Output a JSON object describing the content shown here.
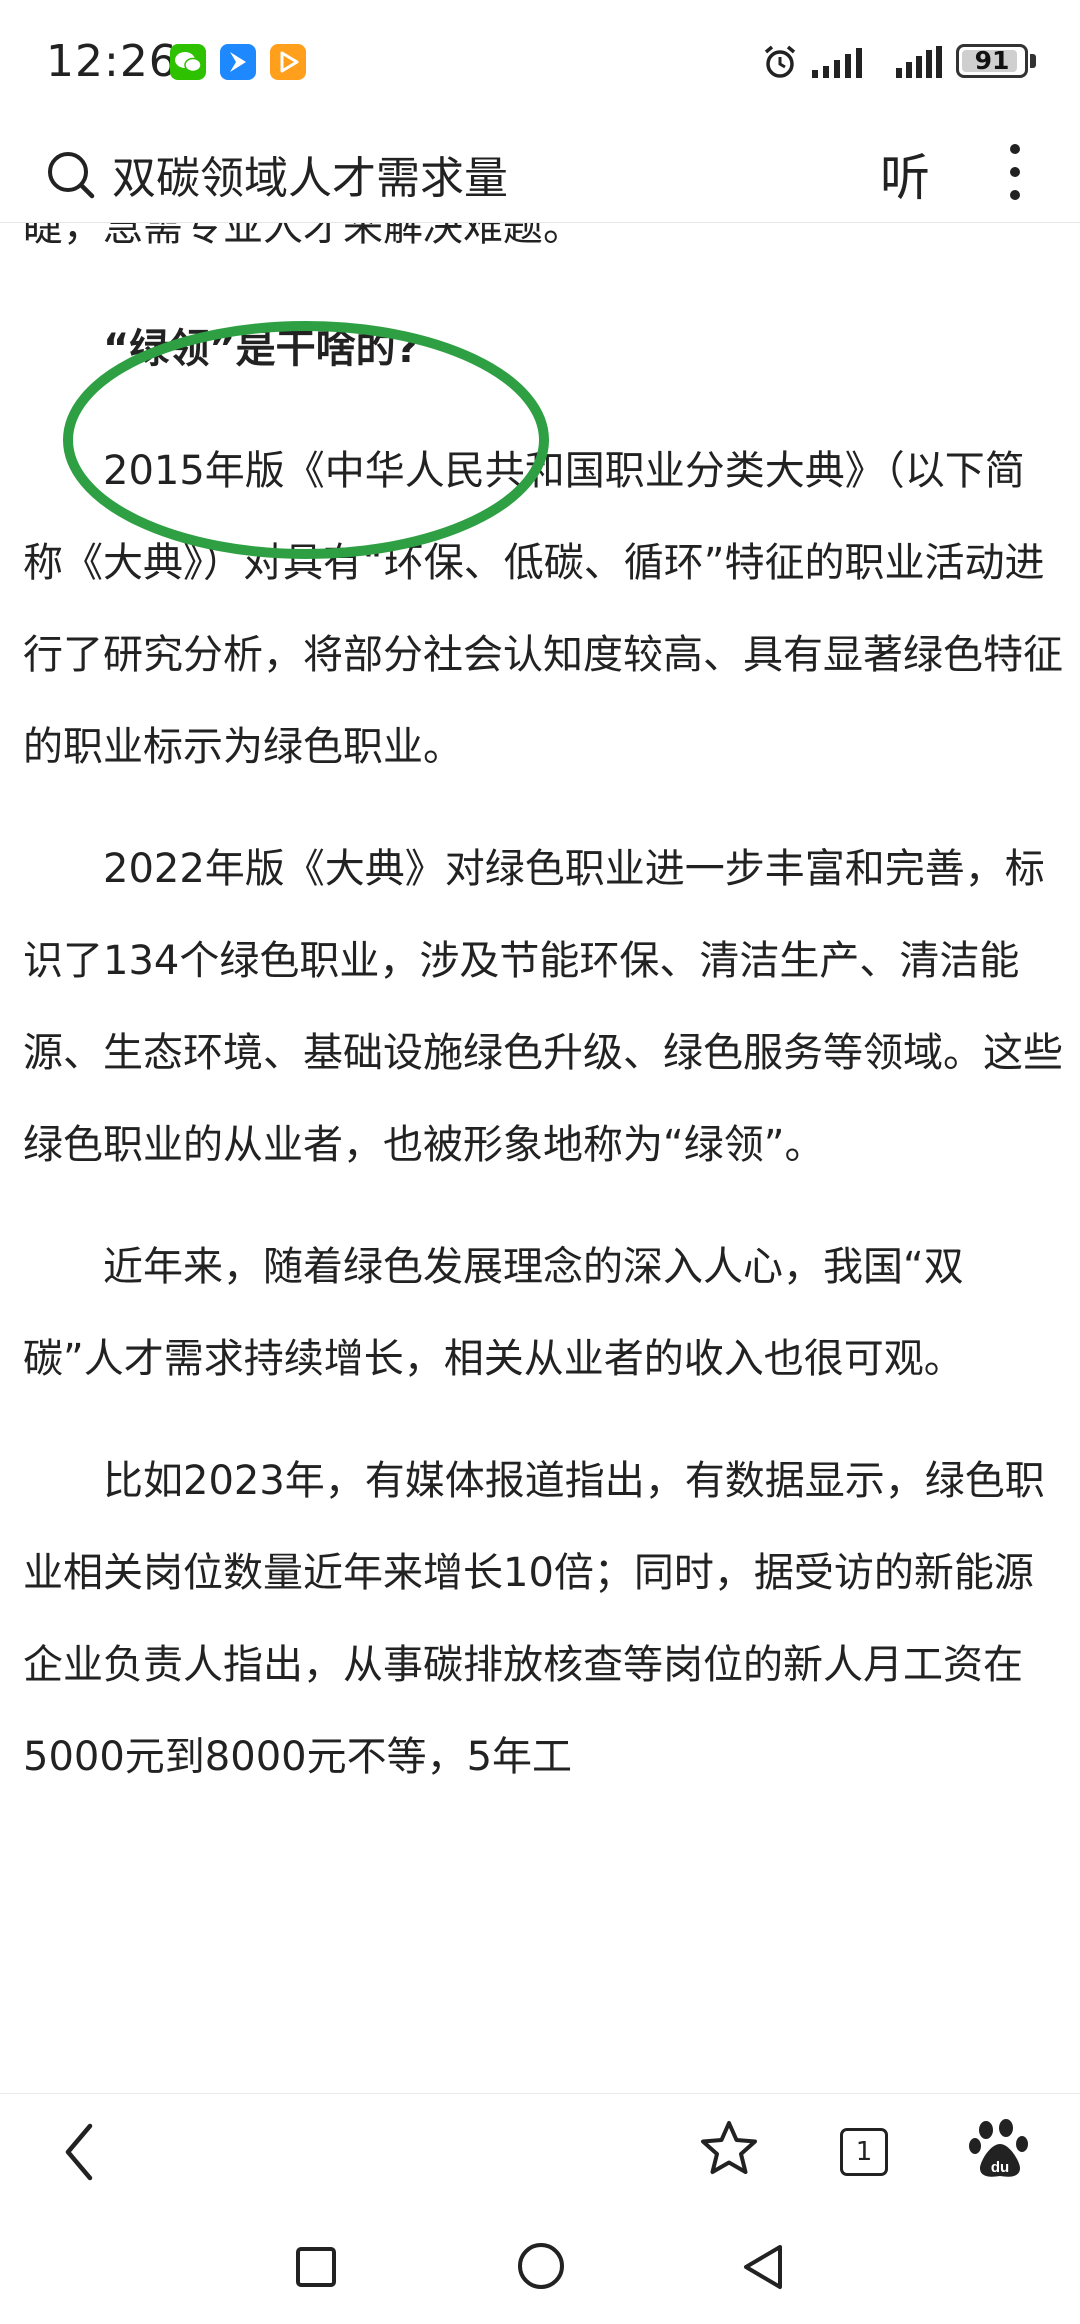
{
  "status_bar": {
    "time": "12:26",
    "battery_level": "91",
    "battery_fraction": 0.91,
    "icons": [
      "wechat-icon",
      "bluebird-app-icon",
      "video-app-icon",
      "alarm-icon",
      "signal-icon",
      "signal-icon",
      "battery-icon"
    ]
  },
  "header": {
    "search_text": "双碳领域人才需求量",
    "listen_label": "听",
    "search_icon": "search-icon",
    "more_icon": "more-vertical-icon"
  },
  "article": {
    "paragraphs": [
      "睫，急需专业人才来解决难题。",
      "“绿领”是干啥的?",
      "2015年版《中华人民共和国职业分类大典》（以下简称《大典》）对具有“环保、低碳、循环”特征的职业活动进行了研究分析，将部分社会认知度较高、具有显著绿色特征的职业标示为绿色职业。",
      "2022年版《大典》对绿色职业进一步丰富和完善，标识了134个绿色职业，涉及节能环保、清洁生产、清洁能源、生态环境、基础设施绿色升级、绿色服务等领域。这些绿色职业的从业者，也被形象地称为“绿领”。",
      "近年来，随着绿色发展理念的深入人心，我国“双碳”人才需求持续增长，相关从业者的收入也很可观。",
      "比如2023年，有媒体报道指出，有数据显示，绿色职业相关岗位数量近年来增长10倍；同时，据受访的新能源企业负责人指出，从事碳排放核查等岗位的新人月工资在5000元到8000元不等，5年工"
    ],
    "highlight_color": "#2ea043"
  },
  "toolbar": {
    "tab_count": "1",
    "icons": [
      "back-arrow-icon",
      "star-icon",
      "tabs-icon",
      "baidu-paw-icon"
    ]
  },
  "nav_bar": {
    "icons": [
      "square-icon",
      "circle-icon",
      "triangle-back-icon"
    ]
  }
}
